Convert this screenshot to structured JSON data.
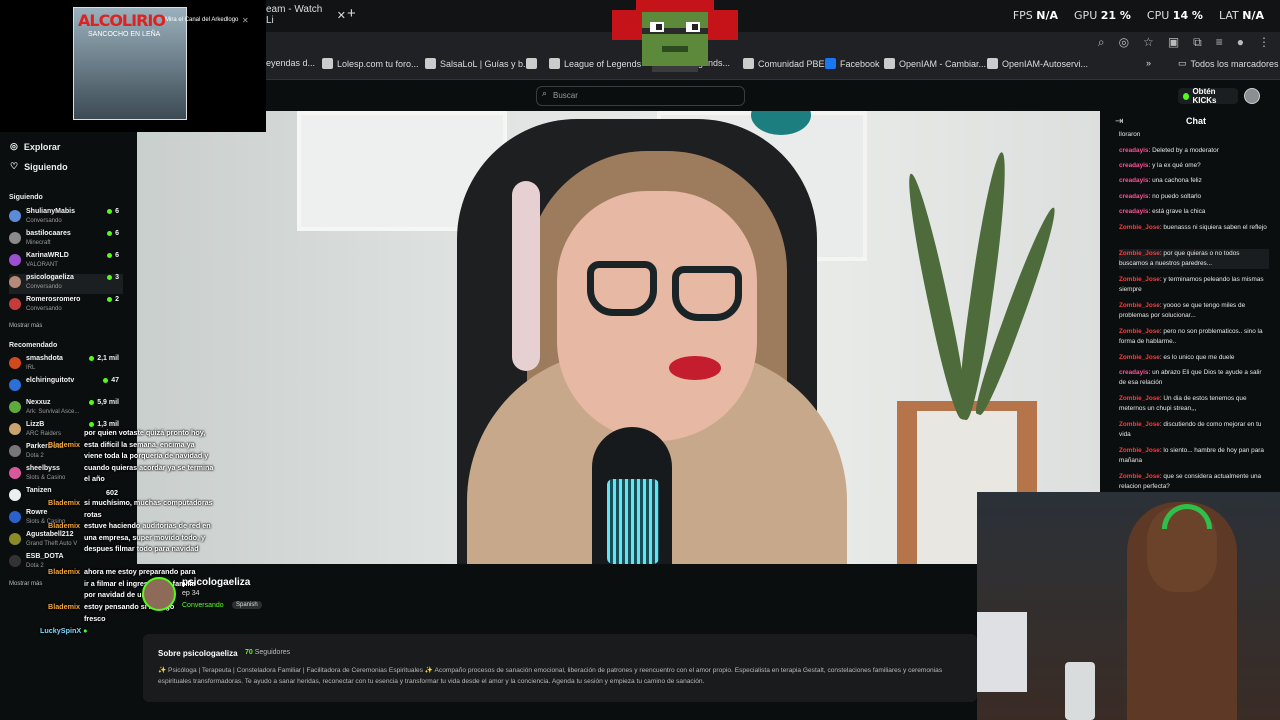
{
  "browser": {
    "tab_title": "eam - Watch Li",
    "perf": {
      "fps_label": "FPS",
      "fps_value": "N/A",
      "gpu_label": "GPU",
      "gpu_value": "21 %",
      "cpu_label": "CPU",
      "cpu_value": "14 %",
      "lat_label": "LAT",
      "lat_value": "N/A"
    },
    "bookmarks": [
      "eyendas d...",
      "Lolesp.com tu foro...",
      "SalsaLoL | Guías y b...",
      "League of Legends",
      "egends...",
      "Comunidad PBE",
      "Facebook",
      "OpenIAM - Cambiar...",
      "OpenIAM-Autoservi...",
      "Todos los marcadores"
    ]
  },
  "pip": {
    "album_title": "ALCOLIRIO",
    "album_sub": "SANCOCHO EN LEÑA",
    "caption": "Mira el Canal del Arkedlogo"
  },
  "header": {
    "search_placeholder": "Buscar",
    "kicks_label": "Obtén KICKs"
  },
  "sidebar": {
    "explore": "Explorar",
    "following_nav": "Siguiendo",
    "following_title": "Siguiendo",
    "following": [
      {
        "name": "ShulianyMabis",
        "sub": "Conversando",
        "viewers": "6",
        "color": "#5b8bd9"
      },
      {
        "name": "bastilocaares",
        "sub": "Minecraft",
        "viewers": "6",
        "color": "#8a8a8a"
      },
      {
        "name": "KarinaWRLD",
        "sub": "VALORANT",
        "viewers": "6",
        "color": "#9b4fd1"
      },
      {
        "name": "psicologaeliza",
        "sub": "Conversando",
        "viewers": "3",
        "color": "#b68a78"
      },
      {
        "name": "Romerosromero",
        "sub": "Conversando",
        "viewers": "2",
        "color": "#c43c3c"
      }
    ],
    "more1": "Mostrar más",
    "recommended_title": "Recomendado",
    "recommended": [
      {
        "name": "smashdota",
        "sub": "IRL",
        "viewers": "2,1 mil",
        "color": "#d14a1f"
      },
      {
        "name": "elchiringuitotv",
        "sub": "",
        "viewers": "47",
        "color": "#2d6fd8"
      },
      {
        "name": "Nexxuz",
        "sub": "Ark: Survival Asce...",
        "viewers": "5,9 mil",
        "color": "#5faa3c"
      },
      {
        "name": "LizzB",
        "sub": "ARC Raiders",
        "viewers": "1,3 mil",
        "color": "#c9a46f"
      },
      {
        "name": "ParkerDota",
        "sub": "Dota 2",
        "viewers": "",
        "color": "#777"
      },
      {
        "name": "sheelbyss",
        "sub": "Slots & Casino",
        "viewers": "",
        "color": "#d8589b"
      },
      {
        "name": "Tanizen",
        "sub": "",
        "viewers": "",
        "color": "#eee"
      },
      {
        "name": "Rowre",
        "sub": "Slots & Casino",
        "viewers": "",
        "color": "#2a62c9"
      },
      {
        "name": "Agustabell212",
        "sub": "Grand Theft Auto V",
        "viewers": "",
        "color": "#8b8b2a"
      },
      {
        "name": "ESB_DOTA",
        "sub": "Dota 2",
        "viewers": "",
        "color": "#333"
      }
    ],
    "more2": "Mostrar más"
  },
  "overlay_chat": [
    {
      "user": "Blademix",
      "text": "por quien votaste quizá pronto hoy, esta difícil la semana, encima ya viene toda la porquería de navidad y cuando quieras acordar ya se termina el año"
    },
    {
      "user": "Blademix",
      "text": "si muchísimo, muchas computadoras rotas"
    },
    {
      "user": "Blademix",
      "text": "estuve haciendo auditorias de red en una empresa, super movido todo, y despues filmar todo para navidad"
    },
    {
      "user": "Blademix",
      "text": "ahora me estoy preparando para ir a filmar el ingreso de la familia por navidad de un cole"
    },
    {
      "user": "Blademix",
      "text": "estoy pensando si lo hago"
    },
    {
      "user": "LuckySpinX",
      "text": ""
    }
  ],
  "overlay_extra": {
    "fresco": "fresco",
    "ep": "ep 34",
    "n602": "602"
  },
  "channel": {
    "name": "psicologaeliza",
    "ep": "ep 34",
    "category": "Conversando",
    "language": "Spanish"
  },
  "about": {
    "title": "Sobre psicologaeliza",
    "followers_count": "70",
    "followers_label": "Seguidores",
    "text": "✨ Psicóloga | Terapeuta | Consteladora Familiar | Facilitadora de Ceremonias Espirituales ✨  Acompaño procesos de sanación emocional, liberación de patrones y reencuentro con el amor propio.  Especialista en terapia Gestalt, constelaciones familiares y ceremonias espirituales transformadoras.  Te ayudo a sanar heridas, reconectar con tu esencia y transformar tu vida desde el amor y la conciencia.  Agenda tu sesión y empieza tu camino de sanación."
  },
  "chat": {
    "title": "Chat",
    "messages": [
      {
        "user": "",
        "text": "lloraron",
        "cls": ""
      },
      {
        "user": "creadayis",
        "text": "Deleted by a moderator",
        "cls": "u-cr"
      },
      {
        "user": "creadayis",
        "text": "y la ex qué ome?",
        "cls": "u-cr"
      },
      {
        "user": "creadayis",
        "text": "una cachona feliz",
        "cls": "u-cr"
      },
      {
        "user": "creadayis",
        "text": "no puedo soltarlo",
        "cls": "u-cr"
      },
      {
        "user": "creadayis",
        "text": "está grave la chica",
        "cls": "u-cr"
      },
      {
        "user": "Zombie_Jose",
        "text": "buenasss ni siquiera saben el reflejo",
        "cls": "u-zo"
      },
      {
        "user": "Zombie_Jose",
        "text": "por que quieras o no todos buscamos a nuestros paredres...",
        "cls": "u-zo"
      },
      {
        "user": "Zombie_Jose",
        "text": "y terminamos peleando las mismas siempre",
        "cls": "u-zo"
      },
      {
        "user": "Zombie_Jose",
        "text": "yoooo se que tengo miles de problemas por solucionar...",
        "cls": "u-zo"
      },
      {
        "user": "Zombie_Jose",
        "text": "pero no son problematicos.. sino la forma de hablarme..",
        "cls": "u-zo"
      },
      {
        "user": "Zombie_Jose",
        "text": "es lo unico que me duele",
        "cls": "u-zo"
      },
      {
        "user": "creadayis",
        "text": "un abrazo Eli que Dios te ayude a salir de esa relación",
        "cls": "u-cr"
      },
      {
        "user": "Zombie_Jose",
        "text": "Un dia de estos tenemos que meternos un chupi strean,,,",
        "cls": "u-zo"
      },
      {
        "user": "Zombie_Jose",
        "text": "discutiendo de como mejorar en tu vida",
        "cls": "u-zo"
      },
      {
        "user": "Zombie_Jose",
        "text": "lo siento... hambre de hoy pan para mañana",
        "cls": "u-zo"
      },
      {
        "user": "Zombie_Jose",
        "text": "que se considera actualmente una relacion perfecta?",
        "cls": "u-zo"
      }
    ]
  }
}
